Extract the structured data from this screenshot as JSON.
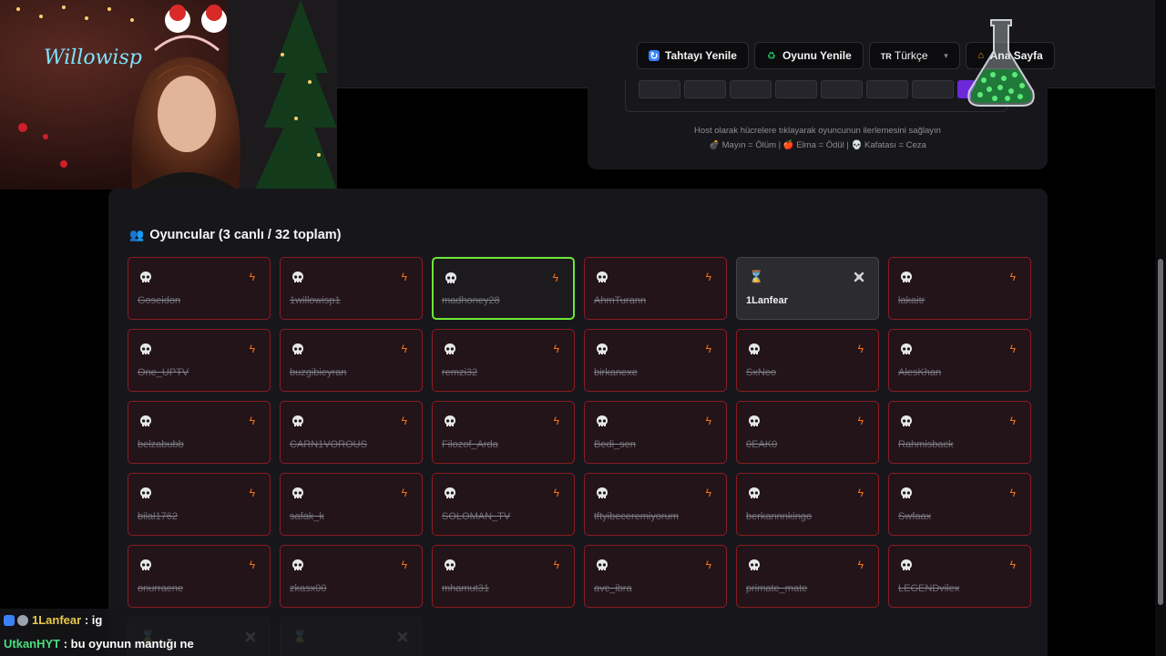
{
  "header": {
    "buttons": {
      "refresh_board": "Tahtayı Yenile",
      "restart_game": "Oyunu Yenile",
      "language_code": "TR",
      "language": "Türkçe",
      "home": "Ana Sayfa"
    }
  },
  "board": {
    "host_note": "Host olarak hücrelere tıklayarak oyuncunun ilerlemesini sağlayın",
    "legend": "💣 Mayın = Ölüm | 🍎 Elma = Ödül | 💀 Kafatası = Ceza"
  },
  "players": {
    "title": "Oyuncular (3 canlı / 32 toplam)",
    "list": [
      {
        "name": "Goseidon",
        "state": "dead"
      },
      {
        "name": "1willowisp1",
        "state": "dead"
      },
      {
        "name": "madhoney28",
        "state": "alive"
      },
      {
        "name": "AhmTurann",
        "state": "dead"
      },
      {
        "name": "1Lanfear",
        "state": "waiting"
      },
      {
        "name": "lakaitr",
        "state": "dead"
      },
      {
        "name": "One_UPTV",
        "state": "dead"
      },
      {
        "name": "buzgibieyran",
        "state": "dead"
      },
      {
        "name": "remzi32",
        "state": "dead"
      },
      {
        "name": "birkanexe",
        "state": "dead"
      },
      {
        "name": "SxNeo",
        "state": "dead"
      },
      {
        "name": "AlesKhan",
        "state": "dead"
      },
      {
        "name": "belzabubb",
        "state": "dead"
      },
      {
        "name": "CARN1VOROUS",
        "state": "dead"
      },
      {
        "name": "Filozof_Arda",
        "state": "dead"
      },
      {
        "name": "Bedi_sen",
        "state": "dead"
      },
      {
        "name": "0EAK0",
        "state": "dead"
      },
      {
        "name": "Rahmisback",
        "state": "dead"
      },
      {
        "name": "bilal1762",
        "state": "dead"
      },
      {
        "name": "safak_k",
        "state": "dead"
      },
      {
        "name": "SOLOMAN_TV",
        "state": "dead"
      },
      {
        "name": "tftyibeceremiyorum",
        "state": "dead"
      },
      {
        "name": "berkannnkingo",
        "state": "dead"
      },
      {
        "name": "Swfaax",
        "state": "dead"
      },
      {
        "name": "onurraene",
        "state": "dead"
      },
      {
        "name": "zkasx00",
        "state": "dead"
      },
      {
        "name": "mhamut31",
        "state": "dead"
      },
      {
        "name": "avc_ibra",
        "state": "dead"
      },
      {
        "name": "primate_mate",
        "state": "dead"
      },
      {
        "name": "LEGENDvilex",
        "state": "dead"
      },
      {
        "name": "",
        "state": "waiting"
      },
      {
        "name": "",
        "state": "waiting"
      }
    ]
  },
  "chat": {
    "messages": [
      {
        "user": "1Lanfear",
        "text": " : ig"
      },
      {
        "user": "UtkanHYT",
        "text": " : bu oyunun mantığı ne"
      }
    ]
  },
  "webcam": {
    "overlay_text": "Willowisp"
  }
}
